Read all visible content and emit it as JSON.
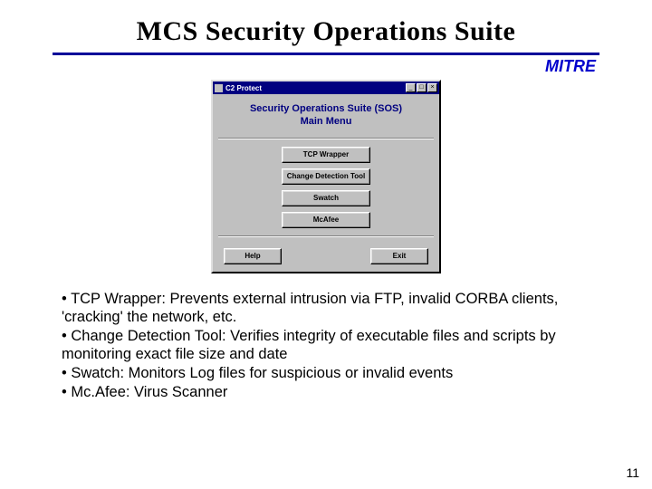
{
  "slide": {
    "title": "MCS Security Operations Suite",
    "brand": "MITRE",
    "page_number": "11"
  },
  "window": {
    "title": "C2 Protect",
    "header_line1": "Security Operations Suite (SOS)",
    "header_line2": "Main Menu",
    "buttons": {
      "tcp": "TCP Wrapper",
      "cdt": "Change Detection Tool",
      "swatch": "Swatch",
      "mcafee": "McAfee",
      "help": "Help",
      "exit": "Exit"
    },
    "controls": {
      "min": "_",
      "max": "□",
      "close": "×"
    }
  },
  "bullets": {
    "b1": "• TCP Wrapper: Prevents external intrusion via FTP, invalid CORBA clients, 'cracking' the network, etc.",
    "b2": "• Change Detection Tool: Verifies integrity of executable files and scripts by monitoring exact file size and date",
    "b3": "• Swatch: Monitors Log files for suspicious or invalid events",
    "b4": "• Mc.Afee: Virus Scanner"
  }
}
